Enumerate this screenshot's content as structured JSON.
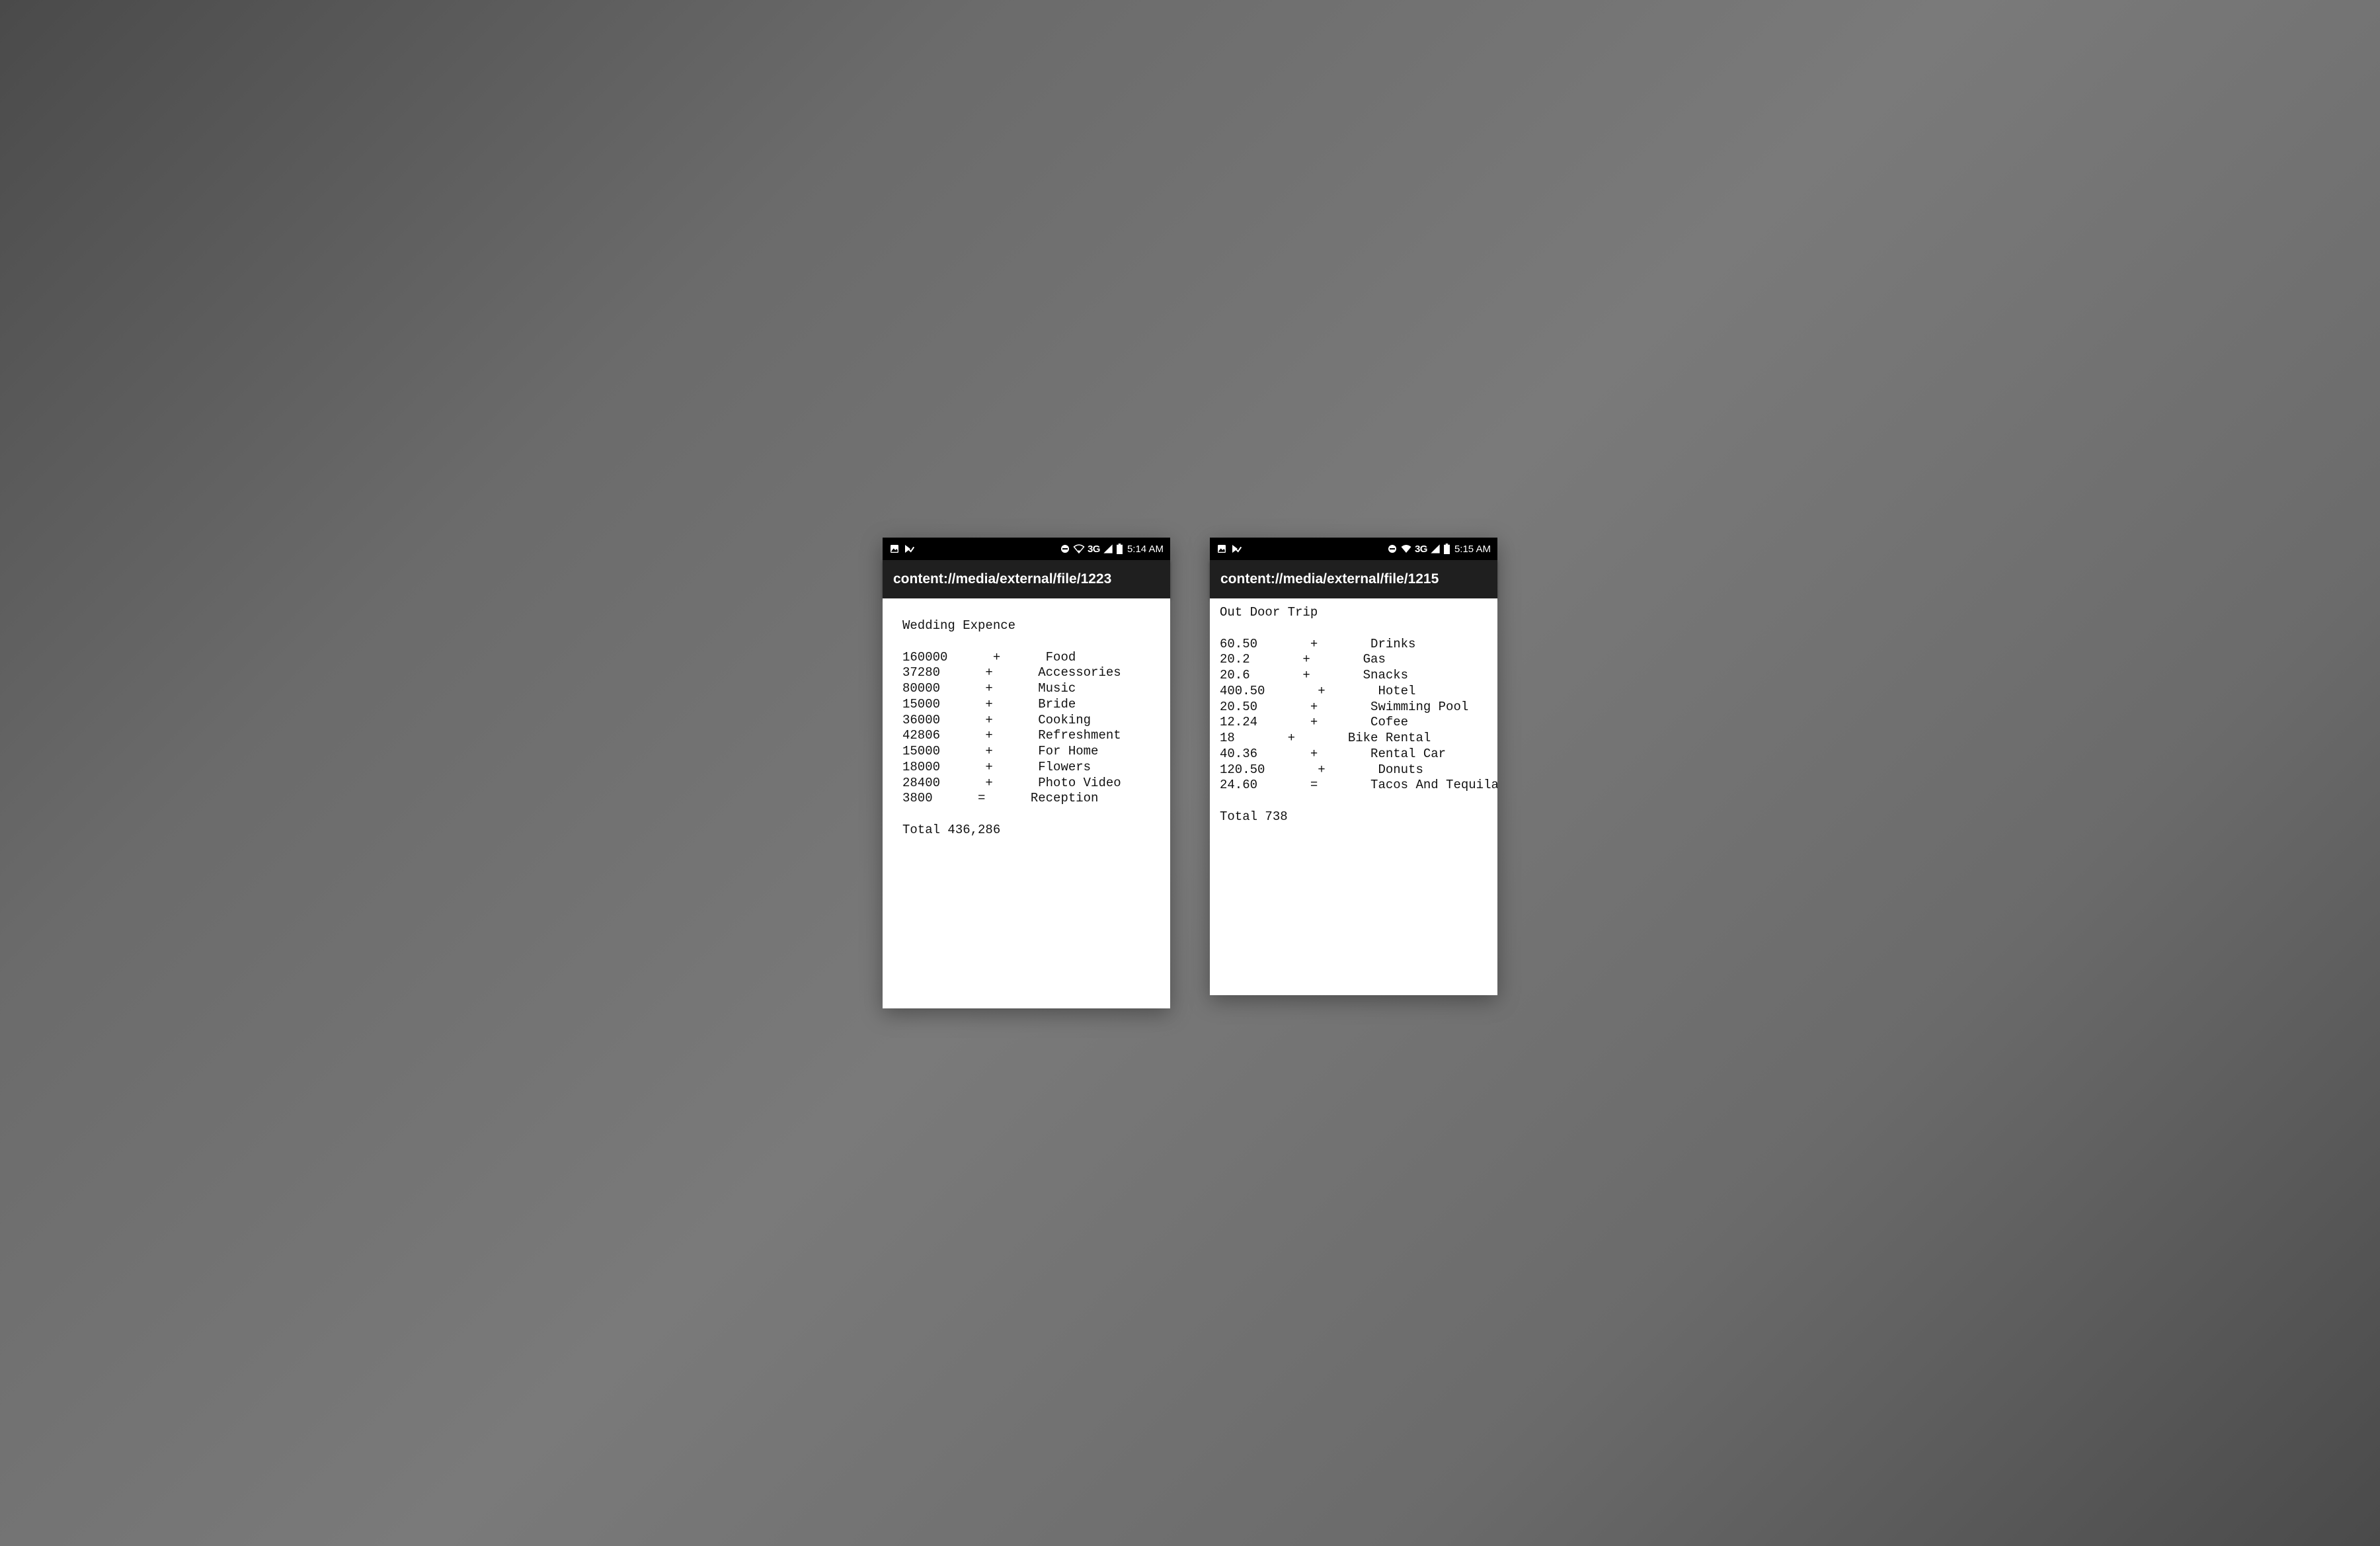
{
  "phones": [
    {
      "status": {
        "time": "5:14 AM",
        "network": "3G",
        "wifi_style": "outline"
      },
      "address": "content://media/external/file/1223",
      "doc": {
        "title": "Wedding Expence",
        "lines": [
          {
            "amount": "160000",
            "op": "+",
            "label": "Food"
          },
          {
            "amount": "37280",
            "op": "+",
            "label": "Accessories"
          },
          {
            "amount": "80000",
            "op": "+",
            "label": "Music"
          },
          {
            "amount": "15000",
            "op": "+",
            "label": "Bride"
          },
          {
            "amount": "36000",
            "op": "+",
            "label": "Cooking"
          },
          {
            "amount": "42806",
            "op": "+",
            "label": "Refreshment"
          },
          {
            "amount": "15000",
            "op": "+",
            "label": "For Home"
          },
          {
            "amount": "18000",
            "op": "+",
            "label": "Flowers"
          },
          {
            "amount": "28400",
            "op": "+",
            "label": "Photo Video"
          },
          {
            "amount": "3800",
            "op": "=",
            "label": "Reception"
          }
        ],
        "total_label": "Total",
        "total_value": "436,286"
      }
    },
    {
      "status": {
        "time": "5:15 AM",
        "network": "3G",
        "wifi_style": "solid"
      },
      "address": "content://media/external/file/1215",
      "doc": {
        "title": "Out Door Trip",
        "lines": [
          {
            "amount": "60.50",
            "op": "+",
            "label": "Drinks"
          },
          {
            "amount": "20.2",
            "op": "+",
            "label": "Gas"
          },
          {
            "amount": "20.6",
            "op": "+",
            "label": "Snacks"
          },
          {
            "amount": "400.50",
            "op": "+",
            "label": "Hotel"
          },
          {
            "amount": "20.50",
            "op": "+",
            "label": "Swimming Pool"
          },
          {
            "amount": "12.24",
            "op": "+",
            "label": "Cofee"
          },
          {
            "amount": "18",
            "op": "+",
            "label": "Bike Rental"
          },
          {
            "amount": "40.36",
            "op": "+",
            "label": "Rental Car"
          },
          {
            "amount": "120.50",
            "op": "+",
            "label": "Donuts"
          },
          {
            "amount": "24.60",
            "op": "=",
            "label": "Tacos And Tequila"
          }
        ],
        "total_label": "Total",
        "total_value": "738"
      }
    }
  ]
}
